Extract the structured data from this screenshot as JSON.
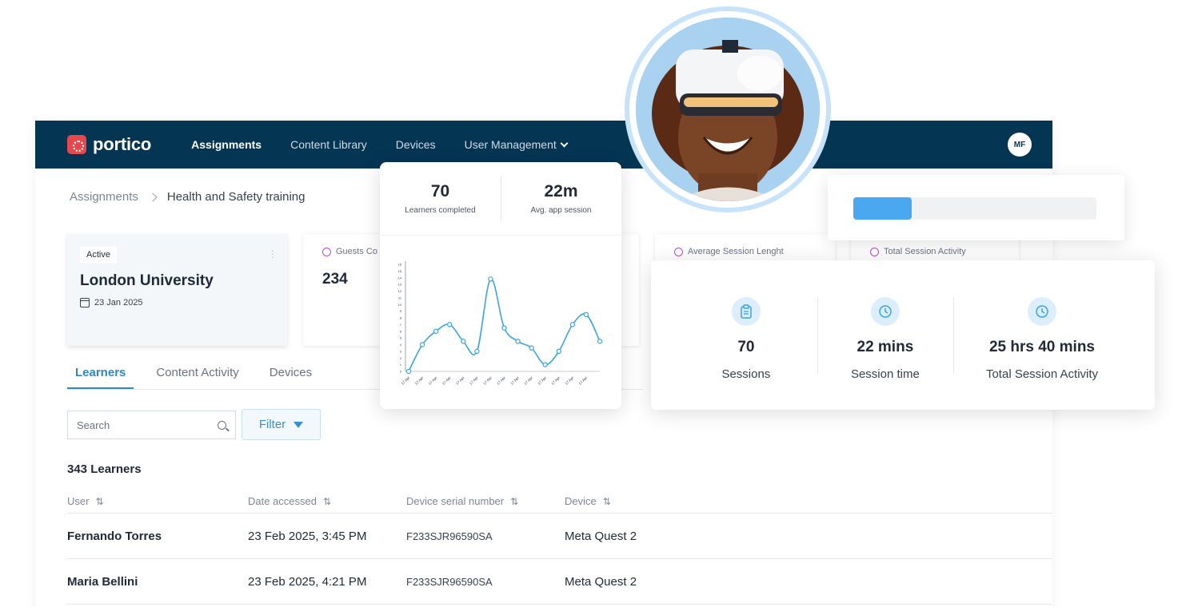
{
  "app": {
    "logo_text": "portico",
    "nav": [
      {
        "label": "Assignments",
        "active": true
      },
      {
        "label": "Content Library"
      },
      {
        "label": "Devices"
      },
      {
        "label": "User Management"
      }
    ],
    "user_initials": "MF"
  },
  "breadcrumb": {
    "root": "Assignments",
    "current": "Health and Safety training"
  },
  "assignment_card": {
    "status": "Active",
    "title": "London University",
    "date": "23 Jan 2025"
  },
  "stat_cards": {
    "guests_label": "Guests Co",
    "guests_value": "234",
    "avg_session_label": "Average Session Lenght",
    "total_activity_label": "Total Session Activity"
  },
  "tabs": [
    {
      "label": "Learners",
      "active": true
    },
    {
      "label": "Content Activity"
    },
    {
      "label": "Devices"
    }
  ],
  "search": {
    "placeholder": "Search"
  },
  "filter_label": "Filter",
  "learners_count": "343 Learners",
  "table": {
    "headers": [
      "User",
      "Date accessed",
      "Device serial number",
      "Device"
    ],
    "rows": [
      {
        "user": "Fernando Torres",
        "date": "23 Feb 2025, 3:45 PM",
        "serial": "F233SJR96590SA",
        "device": "Meta Quest 2"
      },
      {
        "user": "Maria Bellini",
        "date": "23 Feb 2025, 4:21 PM",
        "serial": "F233SJR96590SA",
        "device": "Meta Quest 2"
      }
    ]
  },
  "kpi_card": {
    "learners_completed_value": "70",
    "learners_completed_label": "Learners completed",
    "avg_app_session_value": "22m",
    "avg_app_session_label": "Avg. app session"
  },
  "chart_data": {
    "type": "line",
    "x": [
      "17 Apr",
      "17 Apr",
      "17 Apr",
      "17 Apr",
      "17 Apr",
      "17 Apr",
      "17 Apr",
      "17 Apr",
      "17 Apr",
      "17 Apr",
      "17 Apr",
      "17 Apr",
      "17 Apr",
      "17 Apr"
    ],
    "series": [
      {
        "values": [
          0,
          4,
          6,
          7,
          4.5,
          3,
          13.8,
          6.5,
          4.5,
          3.5,
          1,
          3,
          7,
          8.5,
          4.5
        ]
      }
    ],
    "ylim": [
      0,
      16
    ],
    "yticks": [
      0,
      1,
      2,
      3,
      4,
      5,
      6,
      7,
      8,
      9,
      10,
      11,
      12,
      13,
      14,
      15,
      16
    ],
    "color": "#3aa4e8"
  },
  "progress": {
    "fraction": 0.24,
    "color": "#4aa8f0"
  },
  "sessions_card": {
    "items": [
      {
        "value": "70",
        "label": "Sessions",
        "icon": "clipboard-icon"
      },
      {
        "value": "22 mins",
        "label": "Session time",
        "icon": "clock-icon"
      },
      {
        "value": "25 hrs 40 mins",
        "label": "Total Session Activity",
        "icon": "clock-icon"
      }
    ]
  }
}
